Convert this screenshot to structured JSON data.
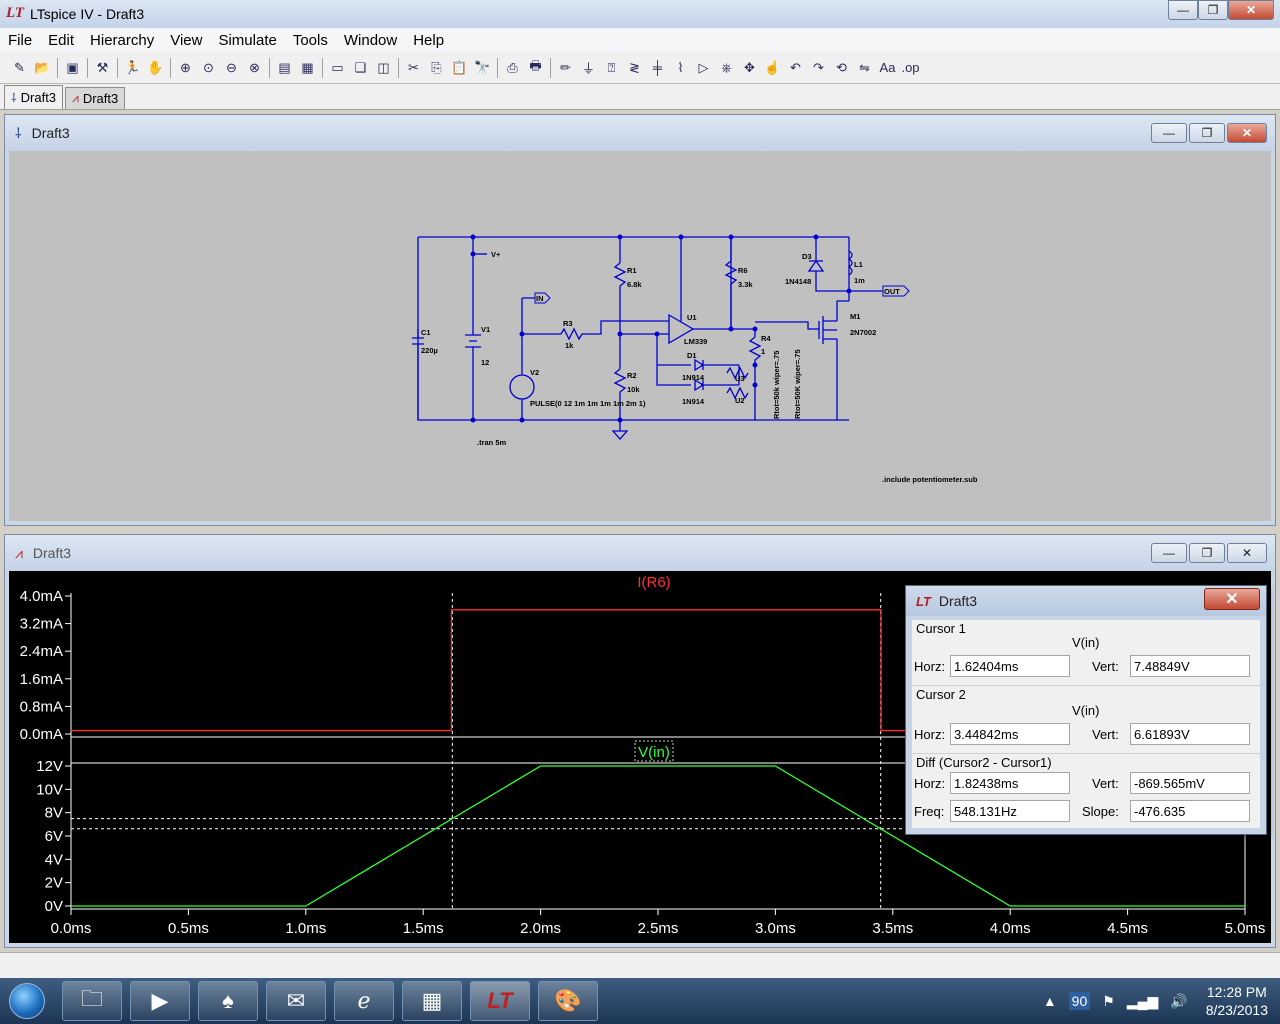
{
  "window": {
    "title": "LTspice IV - Draft3",
    "min": "—",
    "max": "❐",
    "close": "✕"
  },
  "menu": [
    "File",
    "Edit",
    "Hierarchy",
    "View",
    "Simulate",
    "Tools",
    "Window",
    "Help"
  ],
  "tabs": [
    {
      "label": "Draft3",
      "icon": "schematic-icon"
    },
    {
      "label": "Draft3",
      "icon": "waveform-icon"
    }
  ],
  "schematic_window": {
    "title": "Draft3",
    "labels": {
      "vplus": "V+",
      "in": "IN",
      "out": "OUT",
      "c1": "C1",
      "c1v": "220µ",
      "v1": "V1",
      "v1v": "12",
      "v2": "V2",
      "v2v": "PULSE(0 12 1m 1m 1m 1m 2m 1)",
      "r1": "R1",
      "r1v": "6.8k",
      "r2": "R2",
      "r2v": "10k",
      "r3": "R3",
      "r3v": "1k",
      "r6": "R6",
      "r6v": "3.3k",
      "r4": "R4",
      "r4v": "1",
      "u1": "U1",
      "u1v": "LM339",
      "d1": "D1",
      "d1v": "1N914",
      "d2v": "1N914",
      "d3": "D3",
      "d3v": "1N4148",
      "l1": "L1",
      "l1v": "1m",
      "m1": "M1",
      "m1v": "2N7002",
      "u2": "U2",
      "u3": "U3",
      "pot1": "Rtot=50k wiper=.75",
      "pot2": "Rtot=50K wiper=.75",
      "tran": ".tran 5m",
      "include": ".include potentiometer.sub"
    }
  },
  "waveform_window": {
    "title": "Draft3",
    "pane1": {
      "trace": "I(R6)",
      "yticks": [
        "4.0mA",
        "3.2mA",
        "2.4mA",
        "1.6mA",
        "0.8mA",
        "0.0mA"
      ]
    },
    "pane2": {
      "trace": "V(in)",
      "yticks": [
        "12V",
        "10V",
        "8V",
        "6V",
        "4V",
        "2V",
        "0V"
      ]
    },
    "xticks": [
      "0.0ms",
      "0.5ms",
      "1.0ms",
      "1.5ms",
      "2.0ms",
      "2.5ms",
      "3.0ms",
      "3.5ms",
      "4.0ms",
      "4.5ms",
      "5.0ms"
    ]
  },
  "chart_data": [
    {
      "type": "line",
      "title": "I(R6)",
      "xlabel": "",
      "ylabel": "",
      "xlim": [
        0,
        5
      ],
      "ylim": [
        0,
        4.0
      ],
      "series": [
        {
          "name": "I(R6)",
          "color": "#ff3030",
          "x": [
            0,
            1.62,
            1.62,
            3.45,
            3.45,
            5.0
          ],
          "values": [
            0.1,
            0.1,
            3.6,
            3.6,
            0.1,
            0.1
          ]
        }
      ]
    },
    {
      "type": "line",
      "title": "V(in)",
      "xlabel": "",
      "ylabel": "",
      "xlim": [
        0,
        5
      ],
      "ylim": [
        0,
        12
      ],
      "series": [
        {
          "name": "V(in)",
          "color": "#30ff30",
          "x": [
            0,
            1,
            2,
            3,
            4,
            5
          ],
          "values": [
            0,
            0,
            12,
            12,
            0,
            0
          ]
        }
      ],
      "cursors": {
        "x": [
          1.62404,
          3.44842
        ],
        "y": [
          7.48849,
          6.61893
        ]
      }
    }
  ],
  "cursor_dialog": {
    "title": "Draft3",
    "cursor1": {
      "label": "Cursor 1",
      "trace": "V(in)",
      "horz_label": "Horz:",
      "horz": "1.62404ms",
      "vert_label": "Vert:",
      "vert": "7.48849V"
    },
    "cursor2": {
      "label": "Cursor 2",
      "trace": "V(in)",
      "horz_label": "Horz:",
      "horz": "3.44842ms",
      "vert_label": "Vert:",
      "vert": "6.61893V"
    },
    "diff": {
      "label": "Diff (Cursor2 - Cursor1)",
      "horz_label": "Horz:",
      "horz": "1.82438ms",
      "vert_label": "Vert:",
      "vert": "-869.565mV",
      "freq_label": "Freq:",
      "freq": "548.131Hz",
      "slope_label": "Slope:",
      "slope": "-476.635"
    }
  },
  "taskbar": {
    "tray_num": "90",
    "time": "12:28 PM",
    "date": "8/23/2013"
  }
}
